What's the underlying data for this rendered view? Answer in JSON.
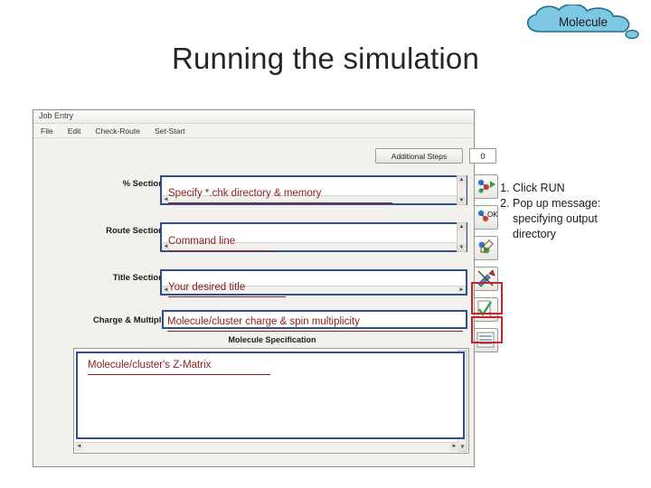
{
  "page_title": "Running the simulation",
  "cloud": {
    "label": "Molecule",
    "fill_color": "#7ec8e3",
    "stroke_color": "#1f6f8b"
  },
  "app_window": {
    "titlebar": "Job Entry",
    "menu": [
      "File",
      "Edit",
      "Check-Route",
      "Set-Start"
    ],
    "additional_steps": {
      "button_label": "Additional Steps",
      "value": "0"
    },
    "sections": [
      {
        "label": "% Section",
        "annotation": "Specify *.chk directory & memory"
      },
      {
        "label": "Route Section",
        "annotation": "Command line"
      },
      {
        "label": "Title Section",
        "annotation": "Your desired title"
      },
      {
        "label": "Charge & Multipl.",
        "annotation": "Molecule/cluster charge & spin multiplicity"
      }
    ],
    "molecule_specification_label": "Molecule Specification",
    "zmatrix_annotation": "Molecule/cluster's Z-Matrix",
    "scroll_arrows": {
      "left": "◄",
      "right": "►",
      "up": "▲",
      "down": "▼"
    },
    "toolbar_icons": [
      "run-molecule-icon",
      "ok-molecule-icon",
      "edit-molecule-icon",
      "tools-icon",
      "checklist-icon",
      "list-view-icon"
    ],
    "highlight_color": "#c0272d",
    "field_border_color": "#2f4f8f",
    "annotation_color": "#8b2020"
  },
  "instructions": {
    "items": [
      "Click RUN",
      "Pop up message: specifying output directory"
    ]
  }
}
